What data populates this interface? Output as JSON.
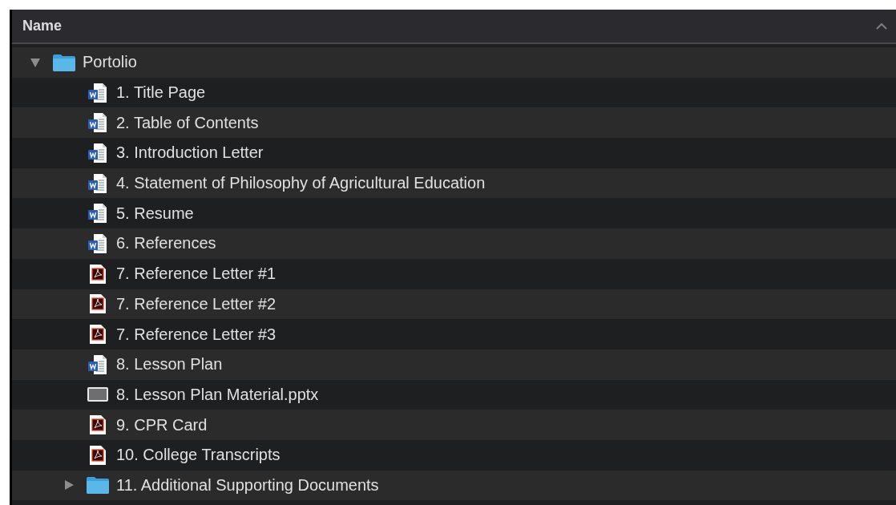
{
  "header": {
    "label": "Name"
  },
  "tree": [
    {
      "kind": "folder",
      "name": "Portolio",
      "expanded": true,
      "children": [
        {
          "kind": "word",
          "name": "1. Title Page"
        },
        {
          "kind": "word",
          "name": "2. Table of Contents"
        },
        {
          "kind": "word",
          "name": "3. Introduction Letter"
        },
        {
          "kind": "word",
          "name": "4. Statement of Philosophy of Agricultural Education"
        },
        {
          "kind": "word",
          "name": "5. Resume"
        },
        {
          "kind": "word",
          "name": "6. References"
        },
        {
          "kind": "pdf",
          "name": "7. Reference Letter #1"
        },
        {
          "kind": "pdf",
          "name": "7. Reference Letter #2"
        },
        {
          "kind": "pdf",
          "name": "7. Reference Letter #3"
        },
        {
          "kind": "word",
          "name": "8. Lesson Plan"
        },
        {
          "kind": "slides",
          "name": "8. Lesson Plan Material.pptx"
        },
        {
          "kind": "pdf",
          "name": "9. CPR Card"
        },
        {
          "kind": "pdf",
          "name": "10. College Transcripts"
        },
        {
          "kind": "folder",
          "name": "11. Additional Supporting Documents",
          "expanded": false
        }
      ]
    }
  ]
}
